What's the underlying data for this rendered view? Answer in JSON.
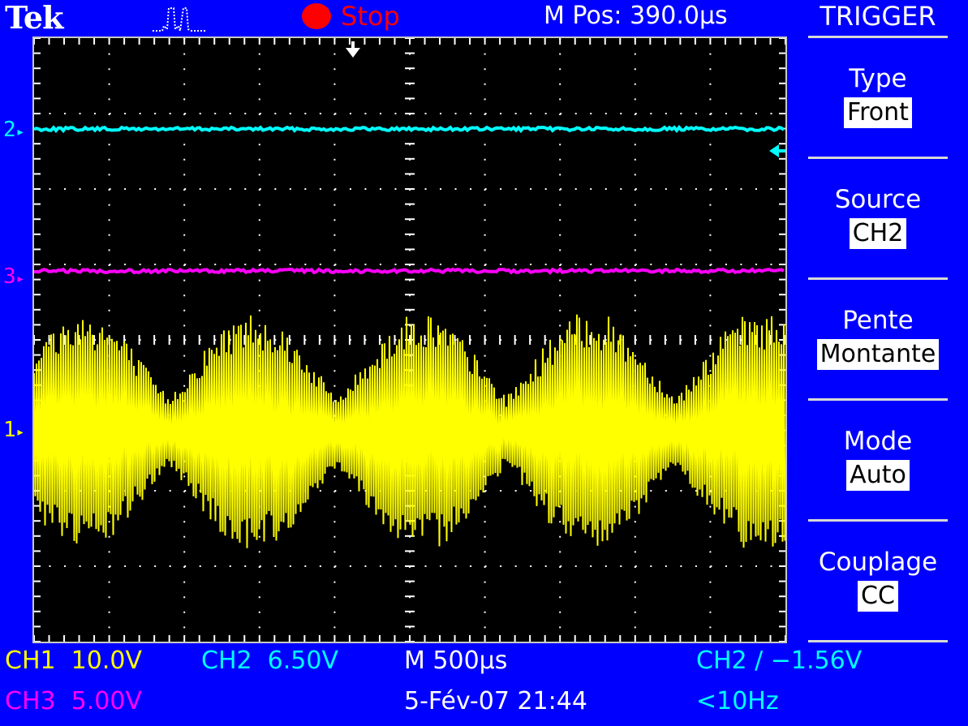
{
  "header": {
    "brand": "Tek",
    "acquisition_icon": "pulse-waveform-icon",
    "run_state": "Stop",
    "horizontal_position": "M Pos: 390.0µs"
  },
  "colors": {
    "background": "#0000ff",
    "ch1": "#ffff00",
    "ch2": "#00ffff",
    "ch3": "#ff00ff",
    "stop": "#ff0000",
    "graticule": "#ffffff"
  },
  "display": {
    "channel_markers": [
      {
        "label": "2",
        "color": "#00ffff"
      },
      {
        "label": "3",
        "color": "#ff00ff"
      },
      {
        "label": "1",
        "color": "#ffff00"
      }
    ],
    "trigger_position_icon": "trigger-position-arrow-icon",
    "trigger_level_icon": "trigger-level-arrow-icon"
  },
  "menu": {
    "title": "TRIGGER",
    "items": [
      {
        "label": "Type",
        "value": "Front"
      },
      {
        "label": "Source",
        "value": "CH2"
      },
      {
        "label": "Pente",
        "value": "Montante"
      },
      {
        "label": "Mode",
        "value": "Auto"
      },
      {
        "label": "Couplage",
        "value": "CC"
      }
    ]
  },
  "footer": {
    "ch1": {
      "name": "CH1",
      "scale": "10.0V"
    },
    "ch2": {
      "name": "CH2",
      "scale": "6.50V"
    },
    "ch3": {
      "name": "CH3",
      "scale": "5.00V"
    },
    "timebase": "M 500µs",
    "trigger_readout": "CH2 ∕ −1.56V",
    "datetime": "5-Fév-07 21:44",
    "frequency": "<10Hz"
  }
}
